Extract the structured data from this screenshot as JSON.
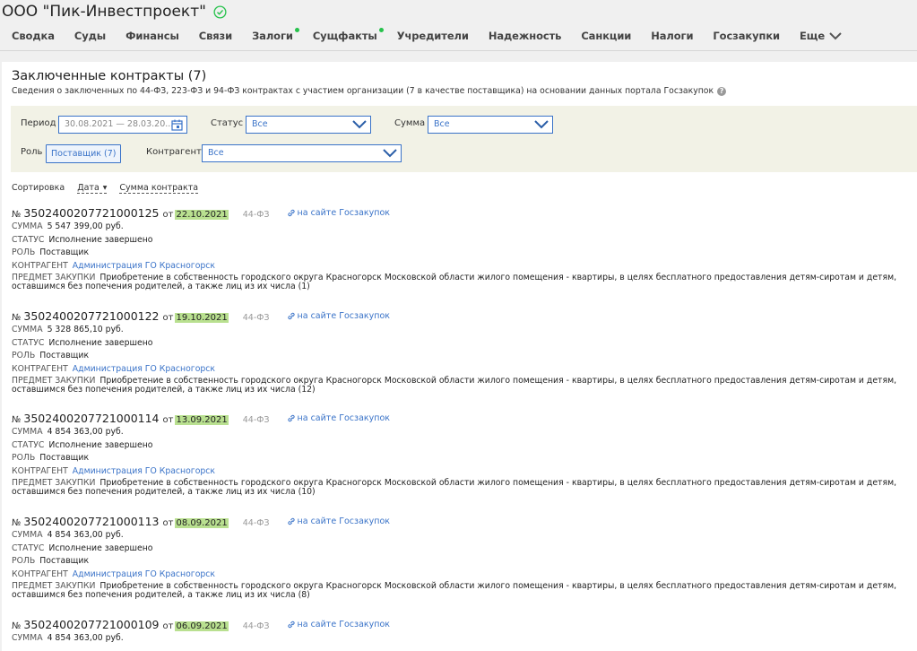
{
  "company": {
    "name": "ООО \"Пик-Инвестпроект\""
  },
  "nav": {
    "items": [
      {
        "label": "Сводка",
        "dot": false
      },
      {
        "label": "Суды",
        "dot": false
      },
      {
        "label": "Финансы",
        "dot": false
      },
      {
        "label": "Связи",
        "dot": false
      },
      {
        "label": "Залоги",
        "dot": true
      },
      {
        "label": "Сущфакты",
        "dot": true
      },
      {
        "label": "Учредители",
        "dot": false
      },
      {
        "label": "Надежность",
        "dot": false
      },
      {
        "label": "Санкции",
        "dot": false
      },
      {
        "label": "Налоги",
        "dot": false
      },
      {
        "label": "Госзакупки",
        "dot": false
      }
    ],
    "more_label": "Еще"
  },
  "section": {
    "title": "Заключенные контракты (7)",
    "subtitle": "Сведения о заключенных по 44-ФЗ, 223-ФЗ и 94-ФЗ контрактах с участием организации (7 в качестве поставщика) на основании данных портала Госзакупок"
  },
  "filters": {
    "period_label": "Период",
    "period_placeholder": "30.08.2021 — 28.03.20...",
    "status_label": "Статус",
    "status_value": "Все",
    "sum_label": "Сумма",
    "sum_value": "Все",
    "role_label": "Роль",
    "role_value": "Поставщик (7)",
    "counterparty_label": "Контрагент",
    "counterparty_value": "Все"
  },
  "sort": {
    "label": "Сортировка",
    "by_date": "Дата",
    "by_sum": "Сумма контракта"
  },
  "labels": {
    "num_prefix": "№",
    "from": "от",
    "link": "на сайте Госзакупок",
    "sum": "СУММА",
    "status": "СТАТУС",
    "role": "РОЛЬ",
    "counterparty": "КОНТРАГЕНТ",
    "subject": "ПРЕДМЕТ ЗАКУПКИ"
  },
  "contracts": [
    {
      "number": "3502400207721000125",
      "date": "22.10.2021",
      "law": "44-ФЗ",
      "sum": "5 547 399,00 руб.",
      "status": "Исполнение завершено",
      "role": "Поставщик",
      "counterparty": "Администрация ГО Красногорск",
      "subject": "Приобретение в собственность городского округа Красногорск Московской области жилого помещения - квартиры, в целях бесплатного предоставления детям-сиротам и детям, оставшимся без попечения родителей, а также лиц из их числа (1)"
    },
    {
      "number": "3502400207721000122",
      "date": "19.10.2021",
      "law": "44-ФЗ",
      "sum": "5 328 865,10 руб.",
      "status": "Исполнение завершено",
      "role": "Поставщик",
      "counterparty": "Администрация ГО Красногорск",
      "subject": "Приобретение в собственность городского округа Красногорск Московской области жилого помещения - квартиры, в целях бесплатного предоставления детям-сиротам и детям, оставшимся без попечения родителей, а также лиц из их числа (12)"
    },
    {
      "number": "3502400207721000114",
      "date": "13.09.2021",
      "law": "44-ФЗ",
      "sum": "4 854 363,00 руб.",
      "status": "Исполнение завершено",
      "role": "Поставщик",
      "counterparty": "Администрация ГО Красногорск",
      "subject": "Приобретение в собственность городского округа Красногорск Московской области жилого помещения - квартиры, в целях бесплатного предоставления детям-сиротам и детям, оставшимся без попечения родителей, а также лиц из их числа (10)"
    },
    {
      "number": "3502400207721000113",
      "date": "08.09.2021",
      "law": "44-ФЗ",
      "sum": "4 854 363,00 руб.",
      "status": "Исполнение завершено",
      "role": "Поставщик",
      "counterparty": "Администрация ГО Красногорск",
      "subject": "Приобретение в собственность городского округа Красногорск Московской области жилого помещения - квартиры, в целях бесплатного предоставления детям-сиротам и детям, оставшимся без попечения родителей, а также лиц из их числа (8)"
    },
    {
      "number": "3502400207721000109",
      "date": "06.09.2021",
      "law": "44-ФЗ",
      "sum": "4 854 363,00 руб."
    }
  ]
}
